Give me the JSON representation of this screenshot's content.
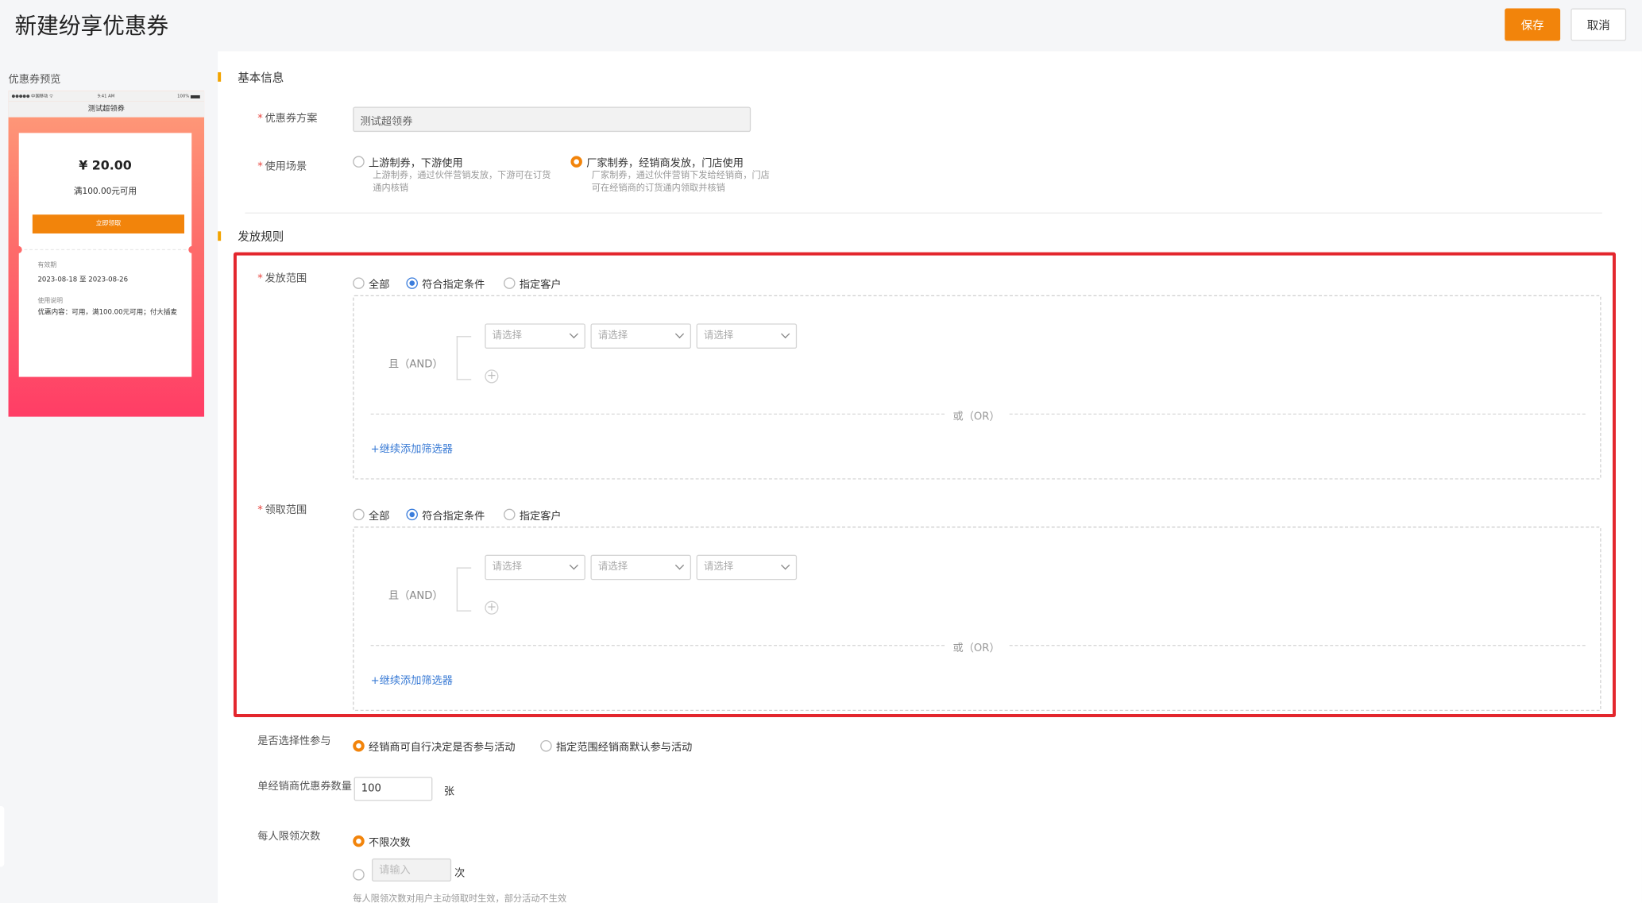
{
  "header": {
    "title": "新建纷享优惠券",
    "save_label": "保存",
    "cancel_label": "取消"
  },
  "preview": {
    "label": "优惠券预览",
    "status_left": "●●●●● 中国移动 ᯤ",
    "status_time": "9:41 AM",
    "status_battery": "100%",
    "nav_title": "测试超领券",
    "amount": "¥ 20.00",
    "condition": "满100.00元可用",
    "claim_button": "立即领取",
    "validity_label": "有效期",
    "validity_value": "2023-08-18 至 2023-08-26",
    "usage_label": "使用说明",
    "usage_value": "优惠内容：可用，满100.00元可用；付大插麦"
  },
  "basic": {
    "section_title": "基本信息",
    "plan_label": "优惠券方案",
    "plan_value": "测试超领券",
    "scene_label": "使用场景",
    "scene_options": [
      {
        "label": "上游制券，下游使用",
        "desc": "上游制券，通过伙伴营销发放，下游可在订货通内核销"
      },
      {
        "label": "厂家制券，经销商发放，门店使用",
        "desc": "厂家制券，通过伙伴营销下发给经销商，门店可在经销商的订货通内领取并核销"
      }
    ]
  },
  "rules": {
    "section_title": "发放规则",
    "issue_scope": {
      "label": "发放范围",
      "options": [
        "全部",
        "符合指定条件",
        "指定客户"
      ],
      "and_label": "且（AND）",
      "select_placeholders": [
        "请选择",
        "请选择",
        "请选择"
      ],
      "or_label": "或（OR）",
      "add_filter": "+继续添加筛选器"
    },
    "claim_scope": {
      "label": "领取范围",
      "options": [
        "全部",
        "符合指定条件",
        "指定客户"
      ],
      "and_label": "且（AND）",
      "select_placeholders": [
        "请选择",
        "请选择",
        "请选择"
      ],
      "or_label": "或（OR）",
      "add_filter": "+继续添加筛选器"
    },
    "optional_join": {
      "label": "是否选择性参与",
      "options": [
        "经销商可自行决定是否参与活动",
        "指定范围经销商默认参与活动"
      ]
    },
    "qty_per_dealer": {
      "label": "单经销商优惠券数量",
      "value": "100",
      "unit": "张"
    },
    "limit_per_person": {
      "label": "每人限领次数",
      "unlimited_label": "不限次数",
      "count_placeholder": "请输入",
      "count_unit": "次",
      "hint": "每人限领次数对用户主动领取时生效，部分活动不生效"
    }
  },
  "colors": {
    "accent": "#f2840b",
    "link": "#3a7bd5",
    "highlight_border": "#e3262d"
  }
}
